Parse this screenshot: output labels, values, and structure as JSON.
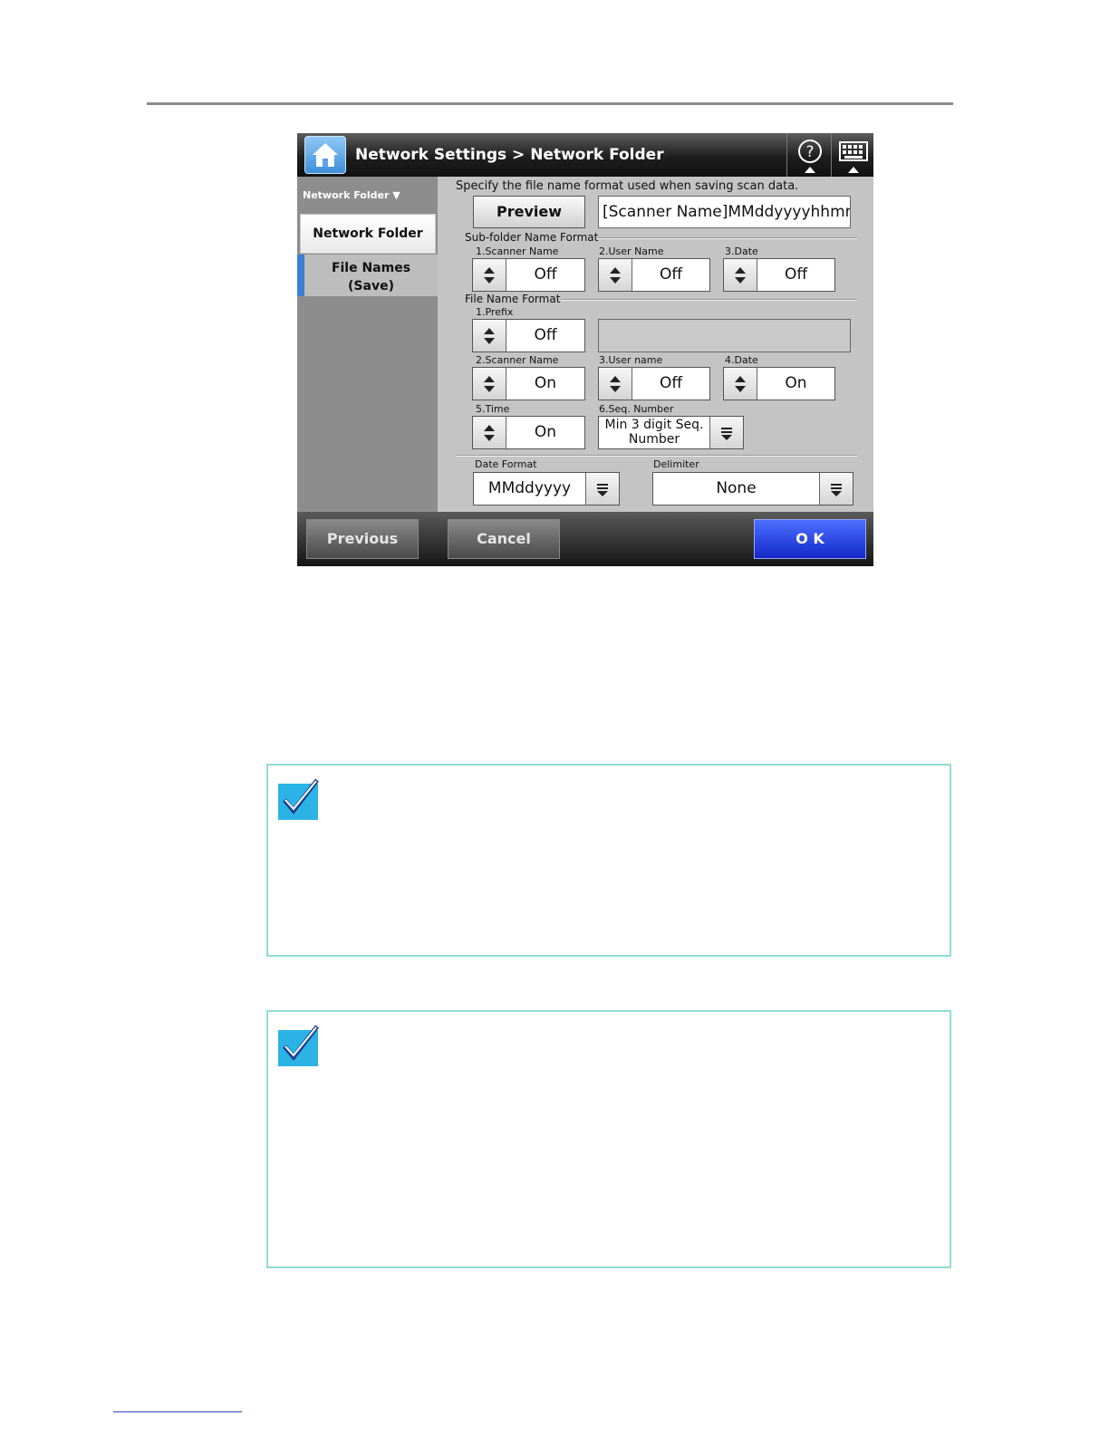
{
  "header": {
    "title": "Network Settings > Network Folder"
  },
  "icons": {
    "home": "home-icon",
    "help": "help-icon",
    "keyboard": "keyboard-icon",
    "note": "checkmark-note-icon"
  },
  "sidebar": {
    "header": "Network Folder ▼",
    "items": [
      {
        "label": "Network Folder"
      },
      {
        "label_line1": "File Names",
        "label_line2": "(Save)"
      }
    ]
  },
  "main": {
    "instruction": "Specify the file name format used when saving scan data.",
    "preview_label": "Preview",
    "preview_value": "[Scanner Name]MMddyyyyhhmmss",
    "subfolder": {
      "title": "Sub-folder Name Format",
      "fields": [
        {
          "label": "1.Scanner Name",
          "value": "Off"
        },
        {
          "label": "2.User Name",
          "value": "Off"
        },
        {
          "label": "3.Date",
          "value": "Off"
        }
      ]
    },
    "filename": {
      "title": "File Name Format",
      "prefix": {
        "label": "1.Prefix",
        "value": "Off",
        "text": ""
      },
      "scanner_name": {
        "label": "2.Scanner Name",
        "value": "On"
      },
      "user_name": {
        "label": "3.User name",
        "value": "Off"
      },
      "date": {
        "label": "4.Date",
        "value": "On"
      },
      "time": {
        "label": "5.Time",
        "value": "On"
      },
      "seq": {
        "label": "6.Seq. Number",
        "value_line1": "Min 3 digit Seq.",
        "value_line2": "Number"
      }
    },
    "date_format": {
      "label": "Date Format",
      "value": "MMddyyyy"
    },
    "delimiter": {
      "label": "Delimiter",
      "value": "None"
    }
  },
  "footer": {
    "previous": "Previous",
    "cancel": "Cancel",
    "ok": "O K"
  },
  "colors": {
    "accent_blue": "#3a7fd2",
    "ok_blue": "#1f3ae0",
    "note_border": "#8fded4",
    "note_icon": "#2bb3e6"
  }
}
